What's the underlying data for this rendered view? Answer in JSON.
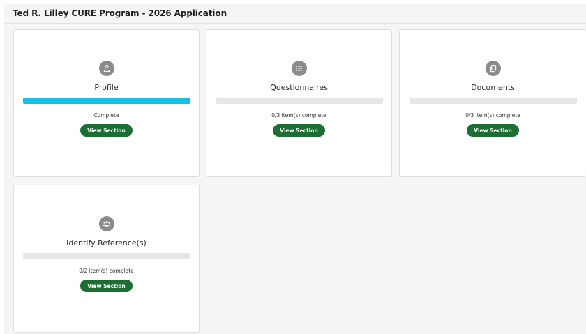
{
  "header": {
    "title": "Ted R. Lilley CURE Program - 2026 Application"
  },
  "sections": [
    {
      "title": "Profile",
      "icon": "user-icon",
      "progress": 1.0,
      "status": "Complete",
      "button": "View Section"
    },
    {
      "title": "Questionnaires",
      "icon": "list-icon",
      "progress": 0.0,
      "status": "0/3 item(s) complete",
      "button": "View Section"
    },
    {
      "title": "Documents",
      "icon": "documents-icon",
      "progress": 0.0,
      "status": "0/3 item(s) complete",
      "button": "View Section"
    },
    {
      "title": "Identify Reference(s)",
      "icon": "people-icon",
      "progress": 0.0,
      "status": "0/2 item(s) complete",
      "button": "View Section"
    }
  ],
  "colors": {
    "progress_fill": "#16c1e8",
    "button_bg": "#1c6e33",
    "icon_bg": "#8b8b8b"
  }
}
